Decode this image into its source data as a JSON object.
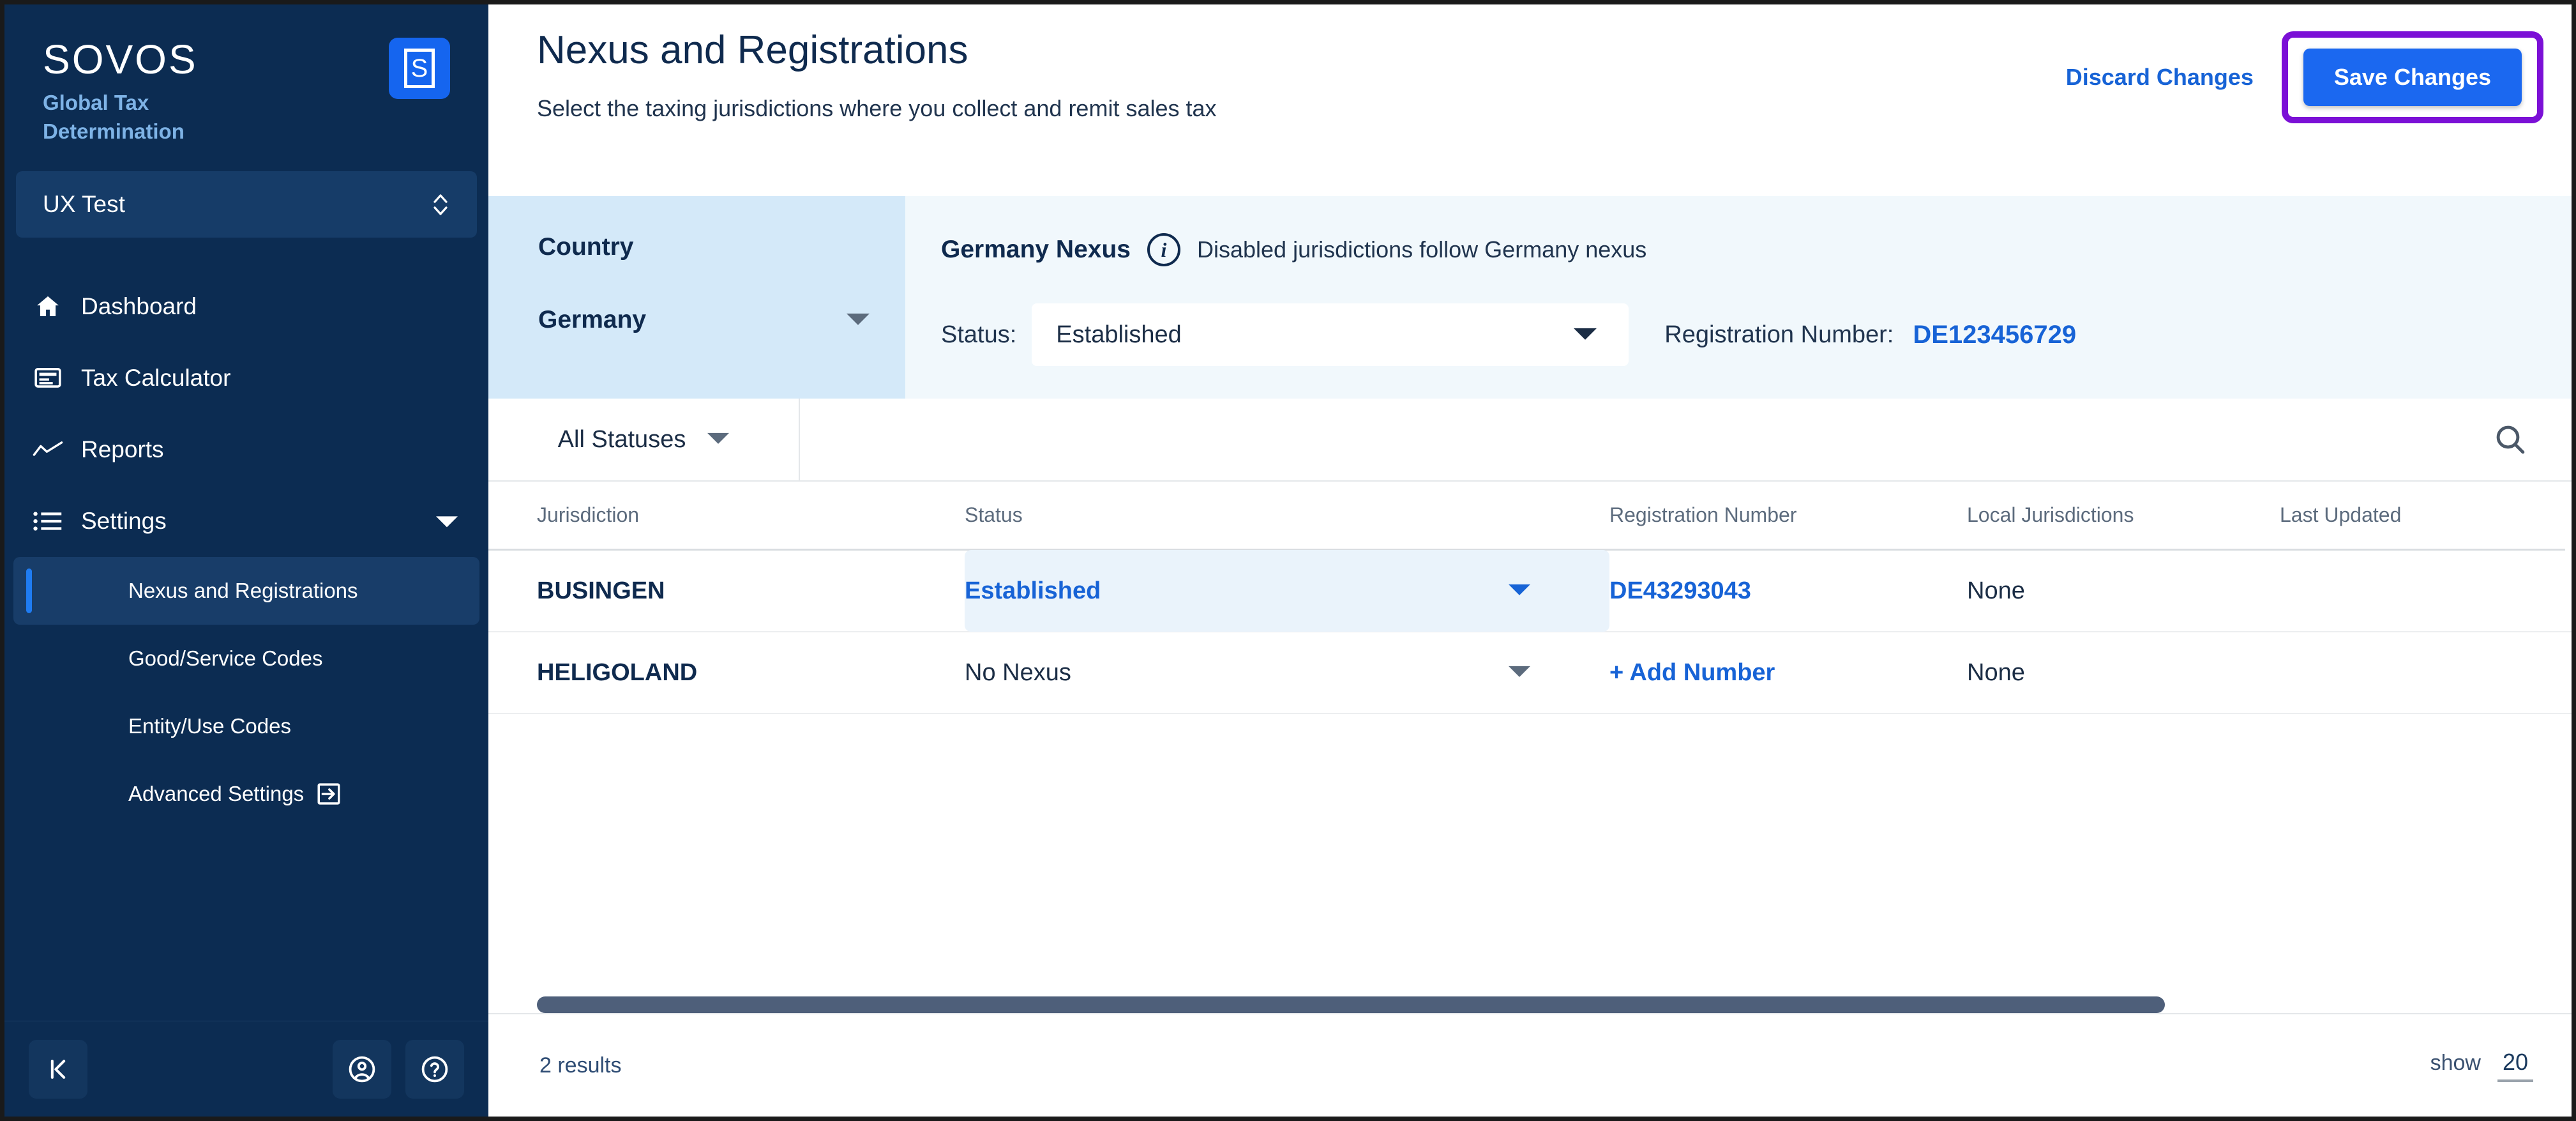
{
  "sidebar": {
    "brand_name": "SOVOS",
    "brand_sub": "Global Tax Determination",
    "logo_letter": "S",
    "tenant": "UX Test",
    "nav": [
      {
        "label": "Dashboard",
        "icon": "home-icon"
      },
      {
        "label": "Tax Calculator",
        "icon": "calculator-icon"
      },
      {
        "label": "Reports",
        "icon": "chart-line-icon"
      },
      {
        "label": "Settings",
        "icon": "list-icon"
      }
    ],
    "subnav": [
      {
        "label": "Nexus and Registrations",
        "active": true
      },
      {
        "label": "Good/Service Codes",
        "active": false
      },
      {
        "label": "Entity/Use Codes",
        "active": false
      },
      {
        "label": "Advanced Settings",
        "active": false,
        "icon": "external-link-icon"
      }
    ],
    "footer": {
      "collapse_icon": "collapse-sidebar-icon",
      "account_icon": "account-circle-icon",
      "help_icon": "help-circle-icon"
    }
  },
  "header": {
    "title": "Nexus and Registrations",
    "subtitle": "Select the taxing jurisdictions where you collect and remit sales tax",
    "discard_label": "Discard Changes",
    "save_label": "Save Changes",
    "highlight_color": "#7b10d6",
    "save_color": "#1b68f0"
  },
  "nexus_panel": {
    "country_label": "Country",
    "country_value": "Germany",
    "title": "Germany Nexus",
    "info_icon": "info-icon",
    "hint": "Disabled jurisdictions follow Germany nexus",
    "status_label": "Status:",
    "status_value": "Established",
    "registration_label": "Registration Number:",
    "registration_value": "DE123456729"
  },
  "filter_bar": {
    "status_filter": "All Statuses",
    "search_icon": "search-icon"
  },
  "table": {
    "columns": [
      "Jurisdiction",
      "Status",
      "Registration Number",
      "Local Jurisdictions",
      "Last Updated"
    ],
    "rows": [
      {
        "jurisdiction": "BUSINGEN",
        "status": "Established",
        "status_highlighted": true,
        "registration": "DE43293043",
        "local_jurisdictions": "None",
        "last_updated": ""
      },
      {
        "jurisdiction": "HELIGOLAND",
        "status": "No Nexus",
        "status_highlighted": false,
        "registration": "+ Add Number",
        "local_jurisdictions": "None",
        "last_updated": ""
      }
    ]
  },
  "footer": {
    "results": "2 results",
    "show_label": "show",
    "show_value": "20"
  }
}
